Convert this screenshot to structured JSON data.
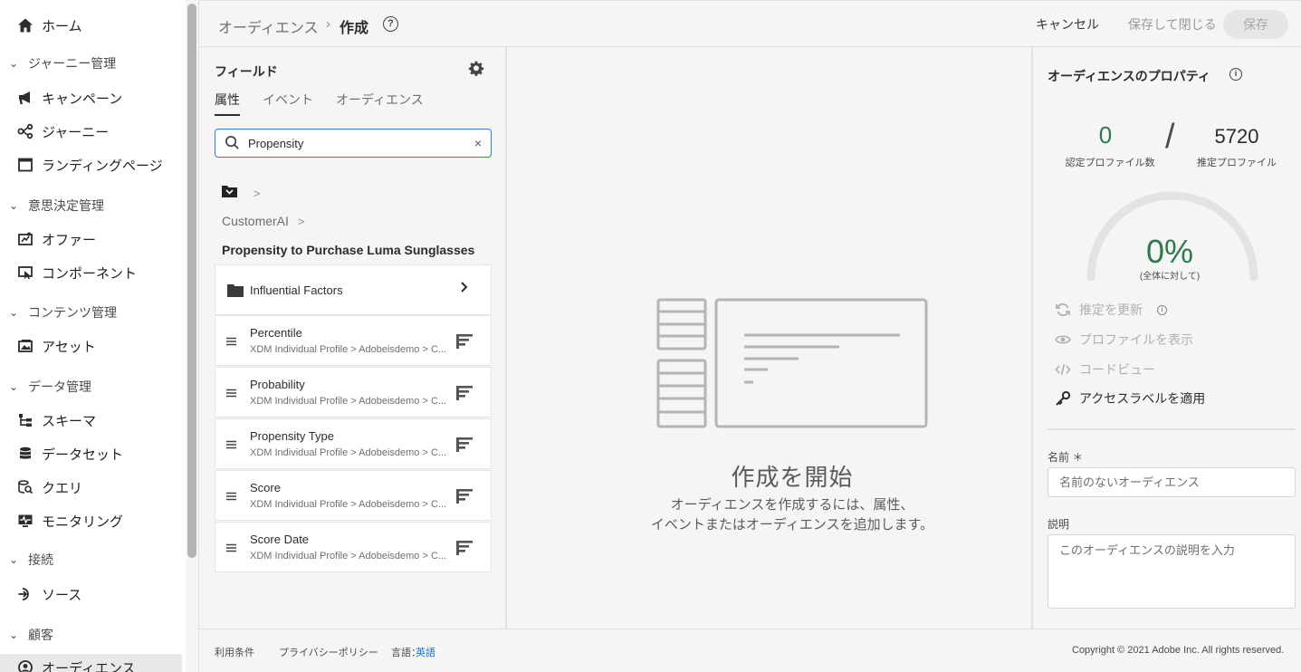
{
  "nav": {
    "home": "ホーム",
    "sections": {
      "journey": "ジャーニー管理",
      "decision": "意思決定管理",
      "content": "コンテンツ管理",
      "data": "データ管理",
      "connections": "接続",
      "customers": "顧客"
    },
    "items": {
      "campaigns": "キャンペーン",
      "journeys": "ジャーニー",
      "landing": "ランディングページ",
      "offers": "オファー",
      "components": "コンポーネント",
      "assets": "アセット",
      "schemas": "スキーマ",
      "datasets": "データセット",
      "queries": "クエリ",
      "monitoring": "モニタリング",
      "sources": "ソース",
      "audiences": "オーディエンス"
    }
  },
  "header": {
    "breadcrumb_parent": "オーディエンス",
    "breadcrumb_sep": "›",
    "breadcrumb_current": "作成",
    "help": "?",
    "cancel": "キャンセル",
    "save_close": "保存して閉じる",
    "save": "保存"
  },
  "fields": {
    "title": "フィールド",
    "tabs": [
      "属性",
      "イベント",
      "オーディエンス"
    ],
    "search_value": "Propensity",
    "clear": "×",
    "crumb_sep": ">",
    "crumb_customerai": "CustomerAI",
    "group_title": "Propensity to Purchase Luma Sunglasses",
    "folder": {
      "label": "Influential Factors",
      "chevron": "›"
    },
    "items": [
      {
        "title": "Percentile",
        "path": "XDM Individual Profile > Adobeisdemo > C..."
      },
      {
        "title": "Probability",
        "path": "XDM Individual Profile > Adobeisdemo > C..."
      },
      {
        "title": "Propensity Type",
        "path": "XDM Individual Profile > Adobeisdemo > C..."
      },
      {
        "title": "Score",
        "path": "XDM Individual Profile > Adobeisdemo > C..."
      },
      {
        "title": "Score Date",
        "path": "XDM Individual Profile > Adobeisdemo > C..."
      }
    ]
  },
  "canvas": {
    "empty_title": "作成を開始",
    "empty_desc_line1": "オーディエンスを作成するには、属性、",
    "empty_desc_line2": "イベントまたはオーディエンスを追加します。"
  },
  "props": {
    "title": "オーディエンスのプロパティ",
    "info": "i",
    "qualified_count": "0",
    "qualified_label": "認定プロファイル数",
    "slash": "/",
    "estimated_count": "5720",
    "estimated_label": "推定プロファイル",
    "percent": "0%",
    "percent_value": 0,
    "percent_sub": "(全体に対して)",
    "actions": {
      "refresh": "推定を更新",
      "view_profiles": "プロファイルを表示",
      "code_view": "コードビュー",
      "access_labels": "アクセスラベルを適用"
    },
    "name_label": "名前 ＊",
    "name_placeholder": "名前のないオーディエンス",
    "desc_label": "説明",
    "desc_placeholder": "このオーディエンスの説明を入力"
  },
  "footer": {
    "terms": "利用条件",
    "privacy": "プライバシーポリシー",
    "language_label": "言語：",
    "language_value": "英語",
    "copyright": "Copyright © 2021 Adobe Inc. All rights reserved."
  },
  "colors": {
    "accent_blue": "#2680eb",
    "success_green": "#2d7a4f"
  }
}
